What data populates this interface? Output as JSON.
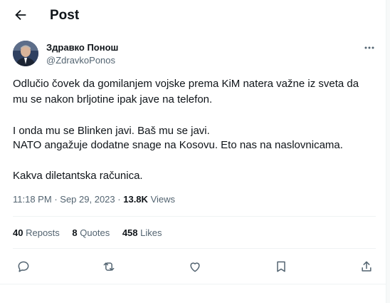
{
  "header": {
    "title": "Post",
    "back_icon": "arrow-left-icon"
  },
  "author": {
    "display_name": "Здравко Понош",
    "handle": "@ZdravkoPonos",
    "avatar_icon": "avatar-portrait"
  },
  "tweet": {
    "paragraphs": [
      "Odlučio čovek da gomilanjem vojske prema KiM natera važne iz sveta da mu se nakon brljotine ipak jave na telefon.",
      "I onda mu se Blinken javi. Baš mu se javi.",
      "NATO angažuje dodatne snage na Kosovu. Eto nas na naslovnicama.",
      "Kakva diletantska računica."
    ]
  },
  "meta": {
    "time": "11:18 PM",
    "separator": "·",
    "date": "Sep 29, 2023",
    "views_count": "13.8K",
    "views_label": "Views"
  },
  "stats": {
    "reposts_count": "40",
    "reposts_label": "Reposts",
    "quotes_count": "8",
    "quotes_label": "Quotes",
    "likes_count": "458",
    "likes_label": "Likes"
  },
  "actions": [
    "reply-icon",
    "repost-icon",
    "like-icon",
    "bookmark-icon",
    "share-icon"
  ],
  "colors": {
    "text": "#0f1419",
    "secondary": "#536471",
    "divider": "#eff3f4"
  }
}
